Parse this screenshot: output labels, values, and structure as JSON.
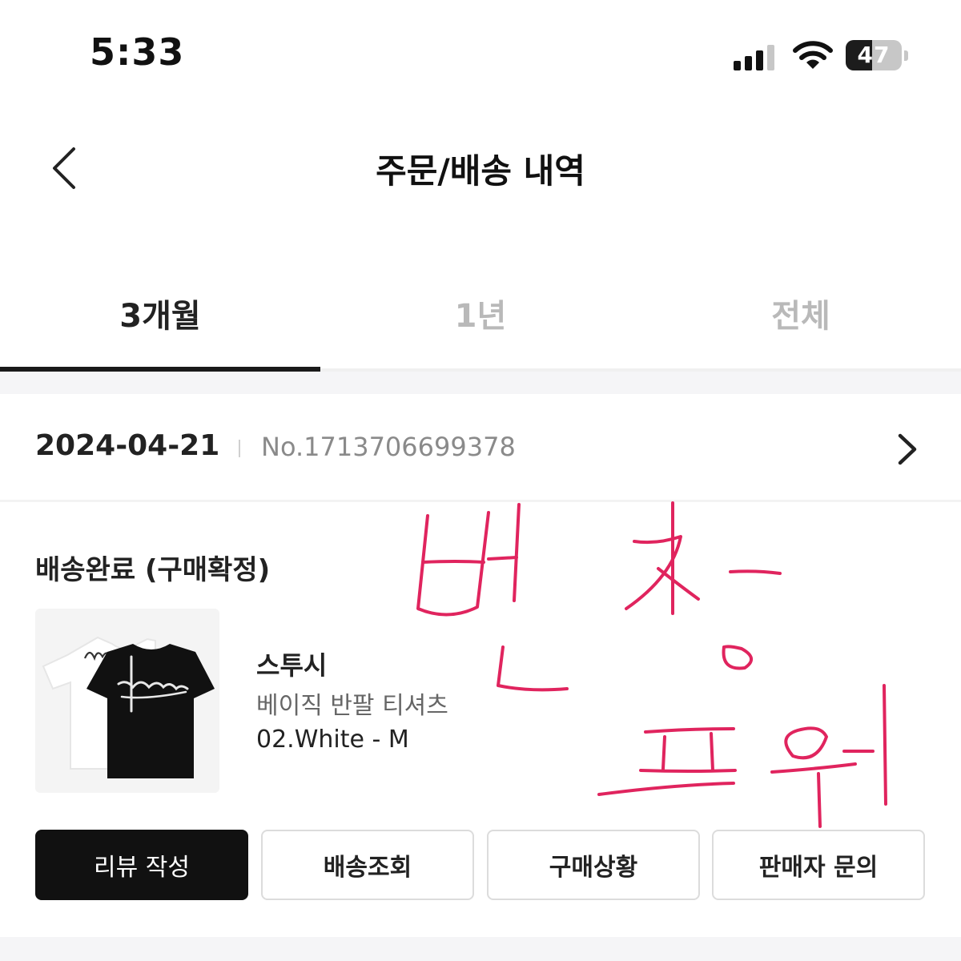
{
  "status_bar": {
    "time": "5:33",
    "battery": "47",
    "battery_level": 0.47,
    "icons": [
      "signal-icon",
      "wifi-icon",
      "battery-icon"
    ]
  },
  "header": {
    "title": "주문/배송 내역",
    "back_icon": "chevron-left-icon"
  },
  "tabs": [
    {
      "label": "3개월",
      "active": true
    },
    {
      "label": "1년",
      "active": false
    },
    {
      "label": "전체",
      "active": false
    }
  ],
  "order": {
    "date": "2024-04-21",
    "number": "No.1713706699378",
    "status": "배송완료 (구매확정)",
    "item": {
      "brand": "스투시",
      "name": "베이직 반팔 티셔츠",
      "option": "02.White - M",
      "image_icon": "black-tshirt-image"
    },
    "actions": [
      "리뷰 작성",
      "배송조회",
      "구매상황",
      "판매자 문의"
    ]
  },
  "annotation": {
    "handwriting": "번장 포워",
    "color": "#e0245e"
  },
  "colors": {
    "text_primary": "#222222",
    "text_muted": "#8a8a8a",
    "primary_button": "#111111",
    "tab_inactive": "#b9b9b9"
  }
}
